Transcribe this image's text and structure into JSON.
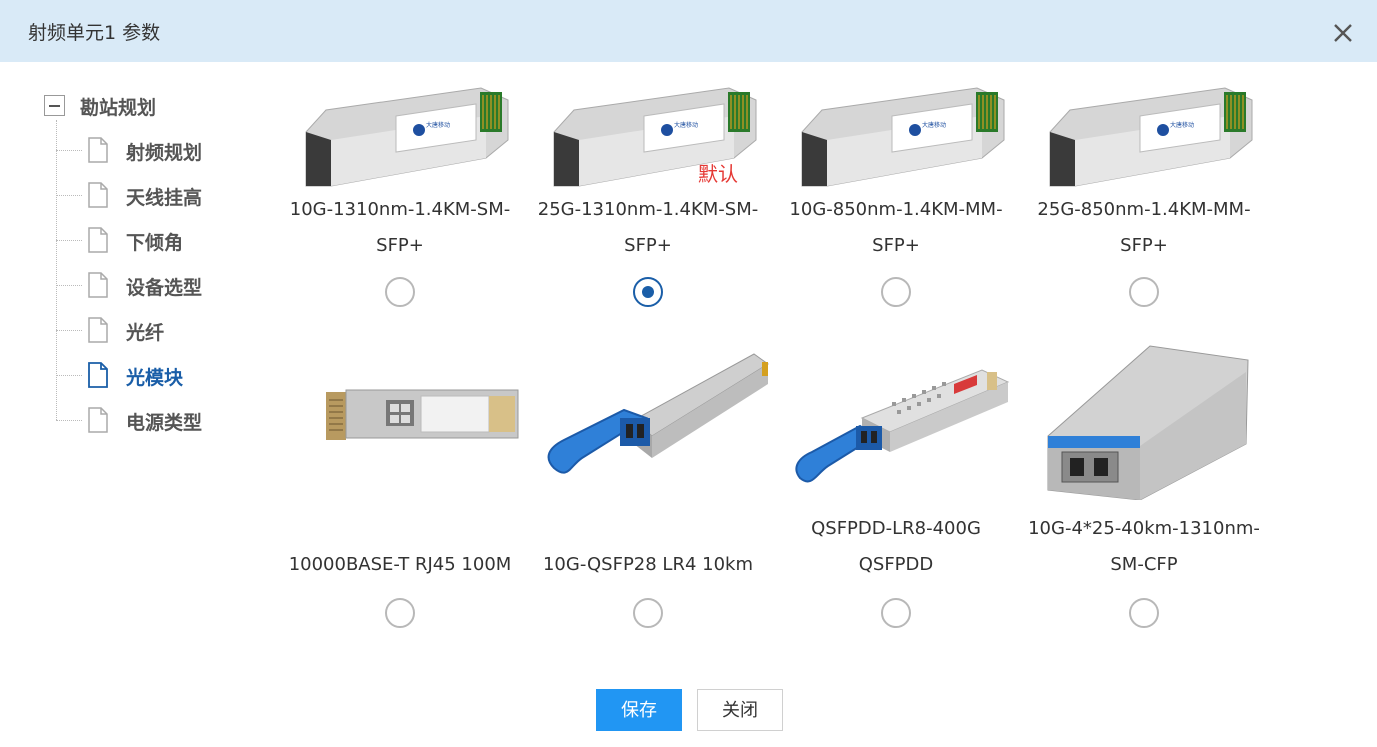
{
  "dialog": {
    "title": "射频单元1 参数",
    "close_icon": "close-icon"
  },
  "tree": {
    "root": {
      "label": "勘站规划",
      "icon": "collapse-minus-icon"
    },
    "items": [
      {
        "label": "射频规划",
        "icon": "document-icon",
        "active": false
      },
      {
        "label": "天线挂高",
        "icon": "document-icon",
        "active": false
      },
      {
        "label": "下倾角",
        "icon": "document-icon",
        "active": false
      },
      {
        "label": "设备选型",
        "icon": "document-icon",
        "active": false
      },
      {
        "label": "光纤",
        "icon": "document-icon",
        "active": false
      },
      {
        "label": "光模块",
        "icon": "document-icon",
        "active": true
      },
      {
        "label": "电源类型",
        "icon": "document-icon",
        "active": false
      }
    ]
  },
  "modules": [
    {
      "name_line1": "10G-1310nm-1.4KM-SM-",
      "name_line2": "SFP+",
      "image": "sfp-module",
      "selected": false
    },
    {
      "name_line1": "25G-1310nm-1.4KM-SM-",
      "name_line2": "SFP+",
      "image": "sfp-module",
      "selected": true,
      "badge": "默认"
    },
    {
      "name_line1": "10G-850nm-1.4KM-MM-",
      "name_line2": "SFP+",
      "image": "sfp-module",
      "selected": false
    },
    {
      "name_line1": "25G-850nm-1.4KM-MM-",
      "name_line2": "SFP+",
      "image": "sfp-module",
      "selected": false
    },
    {
      "name_line1": "",
      "name_line2": "10000BASE-T RJ45 100M",
      "image": "rj45-module",
      "selected": false
    },
    {
      "name_line1": "",
      "name_line2": "10G-QSFP28 LR4 10km",
      "image": "qsfp28-module",
      "selected": false
    },
    {
      "name_line1": "QSFPDD-LR8-400G",
      "name_line2": "QSFPDD",
      "image": "qsfpdd-module",
      "selected": false
    },
    {
      "name_line1": "10G-4*25-40km-1310nm-",
      "name_line2": "SM-CFP",
      "image": "cfp-module",
      "selected": false
    }
  ],
  "sfp_brand": "大唐移动",
  "buttons": {
    "save": "保存",
    "close": "关闭"
  },
  "colors": {
    "titlebar": "#d9eaf7",
    "accent": "#1a5ea8",
    "primary_button": "#2196f3",
    "default_tag": "#e53935",
    "module_blue": "#2f80d8"
  }
}
